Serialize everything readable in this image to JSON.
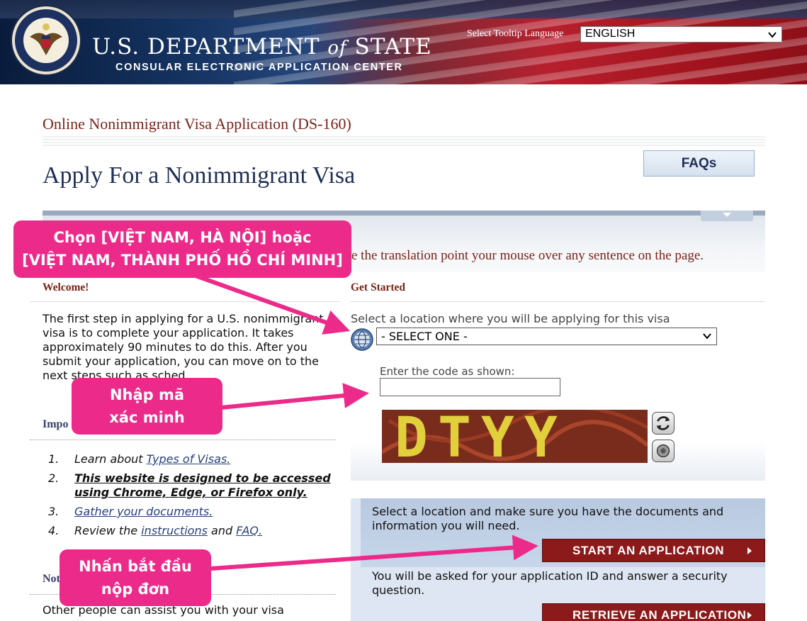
{
  "header": {
    "dept_prefix": "U.S. DEPARTMENT",
    "dept_of": "of",
    "dept_suffix": "STATE",
    "subtitle": "CONSULAR ELECTRONIC APPLICATION CENTER",
    "seal_icon": "department-of-state-seal",
    "tooltip_label": "Select Tooltip Language",
    "tooltip_value": "ENGLISH"
  },
  "page": {
    "form_title": "Online Nonimmigrant Visa Application (DS-160)",
    "title": "Apply For a Nonimmigrant Visa",
    "faq_label": "FAQs",
    "translation_text": "e the translation point your mouse over any sentence on the page."
  },
  "left": {
    "welcome_heading": "Welcome!",
    "welcome_text": "The first step in applying for a U.S. nonimmigrant visa is to complete your application. It takes approximately 90 minutes to do this. After you submit your application, you can move on to the next steps such as sched",
    "important_heading": "Impo",
    "steps": [
      {
        "num": "1.",
        "pre": "Learn about ",
        "link": "Types of Visas."
      },
      {
        "num": "2.",
        "bold": "This website is designed to be accessed using Chrome, Edge, or Firefox only."
      },
      {
        "num": "3.",
        "link": "Gather your documents."
      },
      {
        "num": "4.",
        "pre": "Review the ",
        "link": "instructions",
        "mid": " and ",
        "link2": "FAQ."
      }
    ],
    "notice_heading": "Not",
    "other_text": "Other people can assist you with your visa"
  },
  "right": {
    "heading": "Get Started",
    "location_label": "Select a location where you will be applying for this visa",
    "location_value": "- SELECT ONE -",
    "code_label": "Enter the code as shown:",
    "code_value": "",
    "captcha_text": "DTYY",
    "refresh_icon": "refresh-icon",
    "audio_icon": "audio-icon",
    "start_text": "Select a location and make sure you have the documents and information you will need.",
    "start_button": "START AN APPLICATION",
    "retrieve_text": "You will be asked for your application ID and answer a security question.",
    "retrieve_button": "RETRIEVE AN APPLICATION"
  },
  "annotations": {
    "location_line1": "Chọn [VIỆT NAM, HÀ NỘI] hoặc",
    "location_line2": "[VIỆT NAM, THÀNH PHỐ HỒ CHÍ MINH]",
    "code_line1": "Nhập mã",
    "code_line2": "xác minh",
    "start_line1": "Nhấn bắt đầu",
    "start_line2": "nộp đơn",
    "color": "#ec2a8a"
  },
  "colors": {
    "maroon": "#7a2318",
    "navy": "#1f2f54",
    "button_red": "#8c1a1a"
  }
}
